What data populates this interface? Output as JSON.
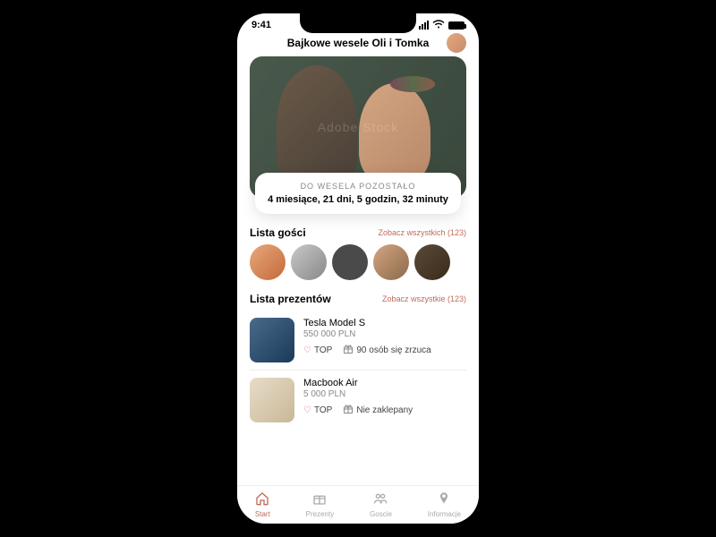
{
  "status": {
    "time": "9:41"
  },
  "header": {
    "title": "Bajkowe wesele Oli i Tomka"
  },
  "hero": {
    "watermark": "Adobe Stock"
  },
  "countdown": {
    "label": "DO WESELA POZOSTAŁO",
    "value": "4 miesiące, 21 dni, 5 godzin, 32 minuty"
  },
  "guests": {
    "title": "Lista gości",
    "see_all": "Zobacz wszystkich (123)"
  },
  "gifts": {
    "title": "Lista prezentów",
    "see_all": "Zobacz wszystkie (123)",
    "items": [
      {
        "name": "Tesla Model S",
        "price": "550 000 PLN",
        "badge": "TOP",
        "status": "90 osób się zrzuca"
      },
      {
        "name": "Macbook Air",
        "price": "5 000 PLN",
        "badge": "TOP",
        "status": "Nie zaklepany"
      }
    ]
  },
  "nav": {
    "start": "Start",
    "prezenty": "Prezenty",
    "goscie": "Goscie",
    "informacje": "Informacje"
  }
}
